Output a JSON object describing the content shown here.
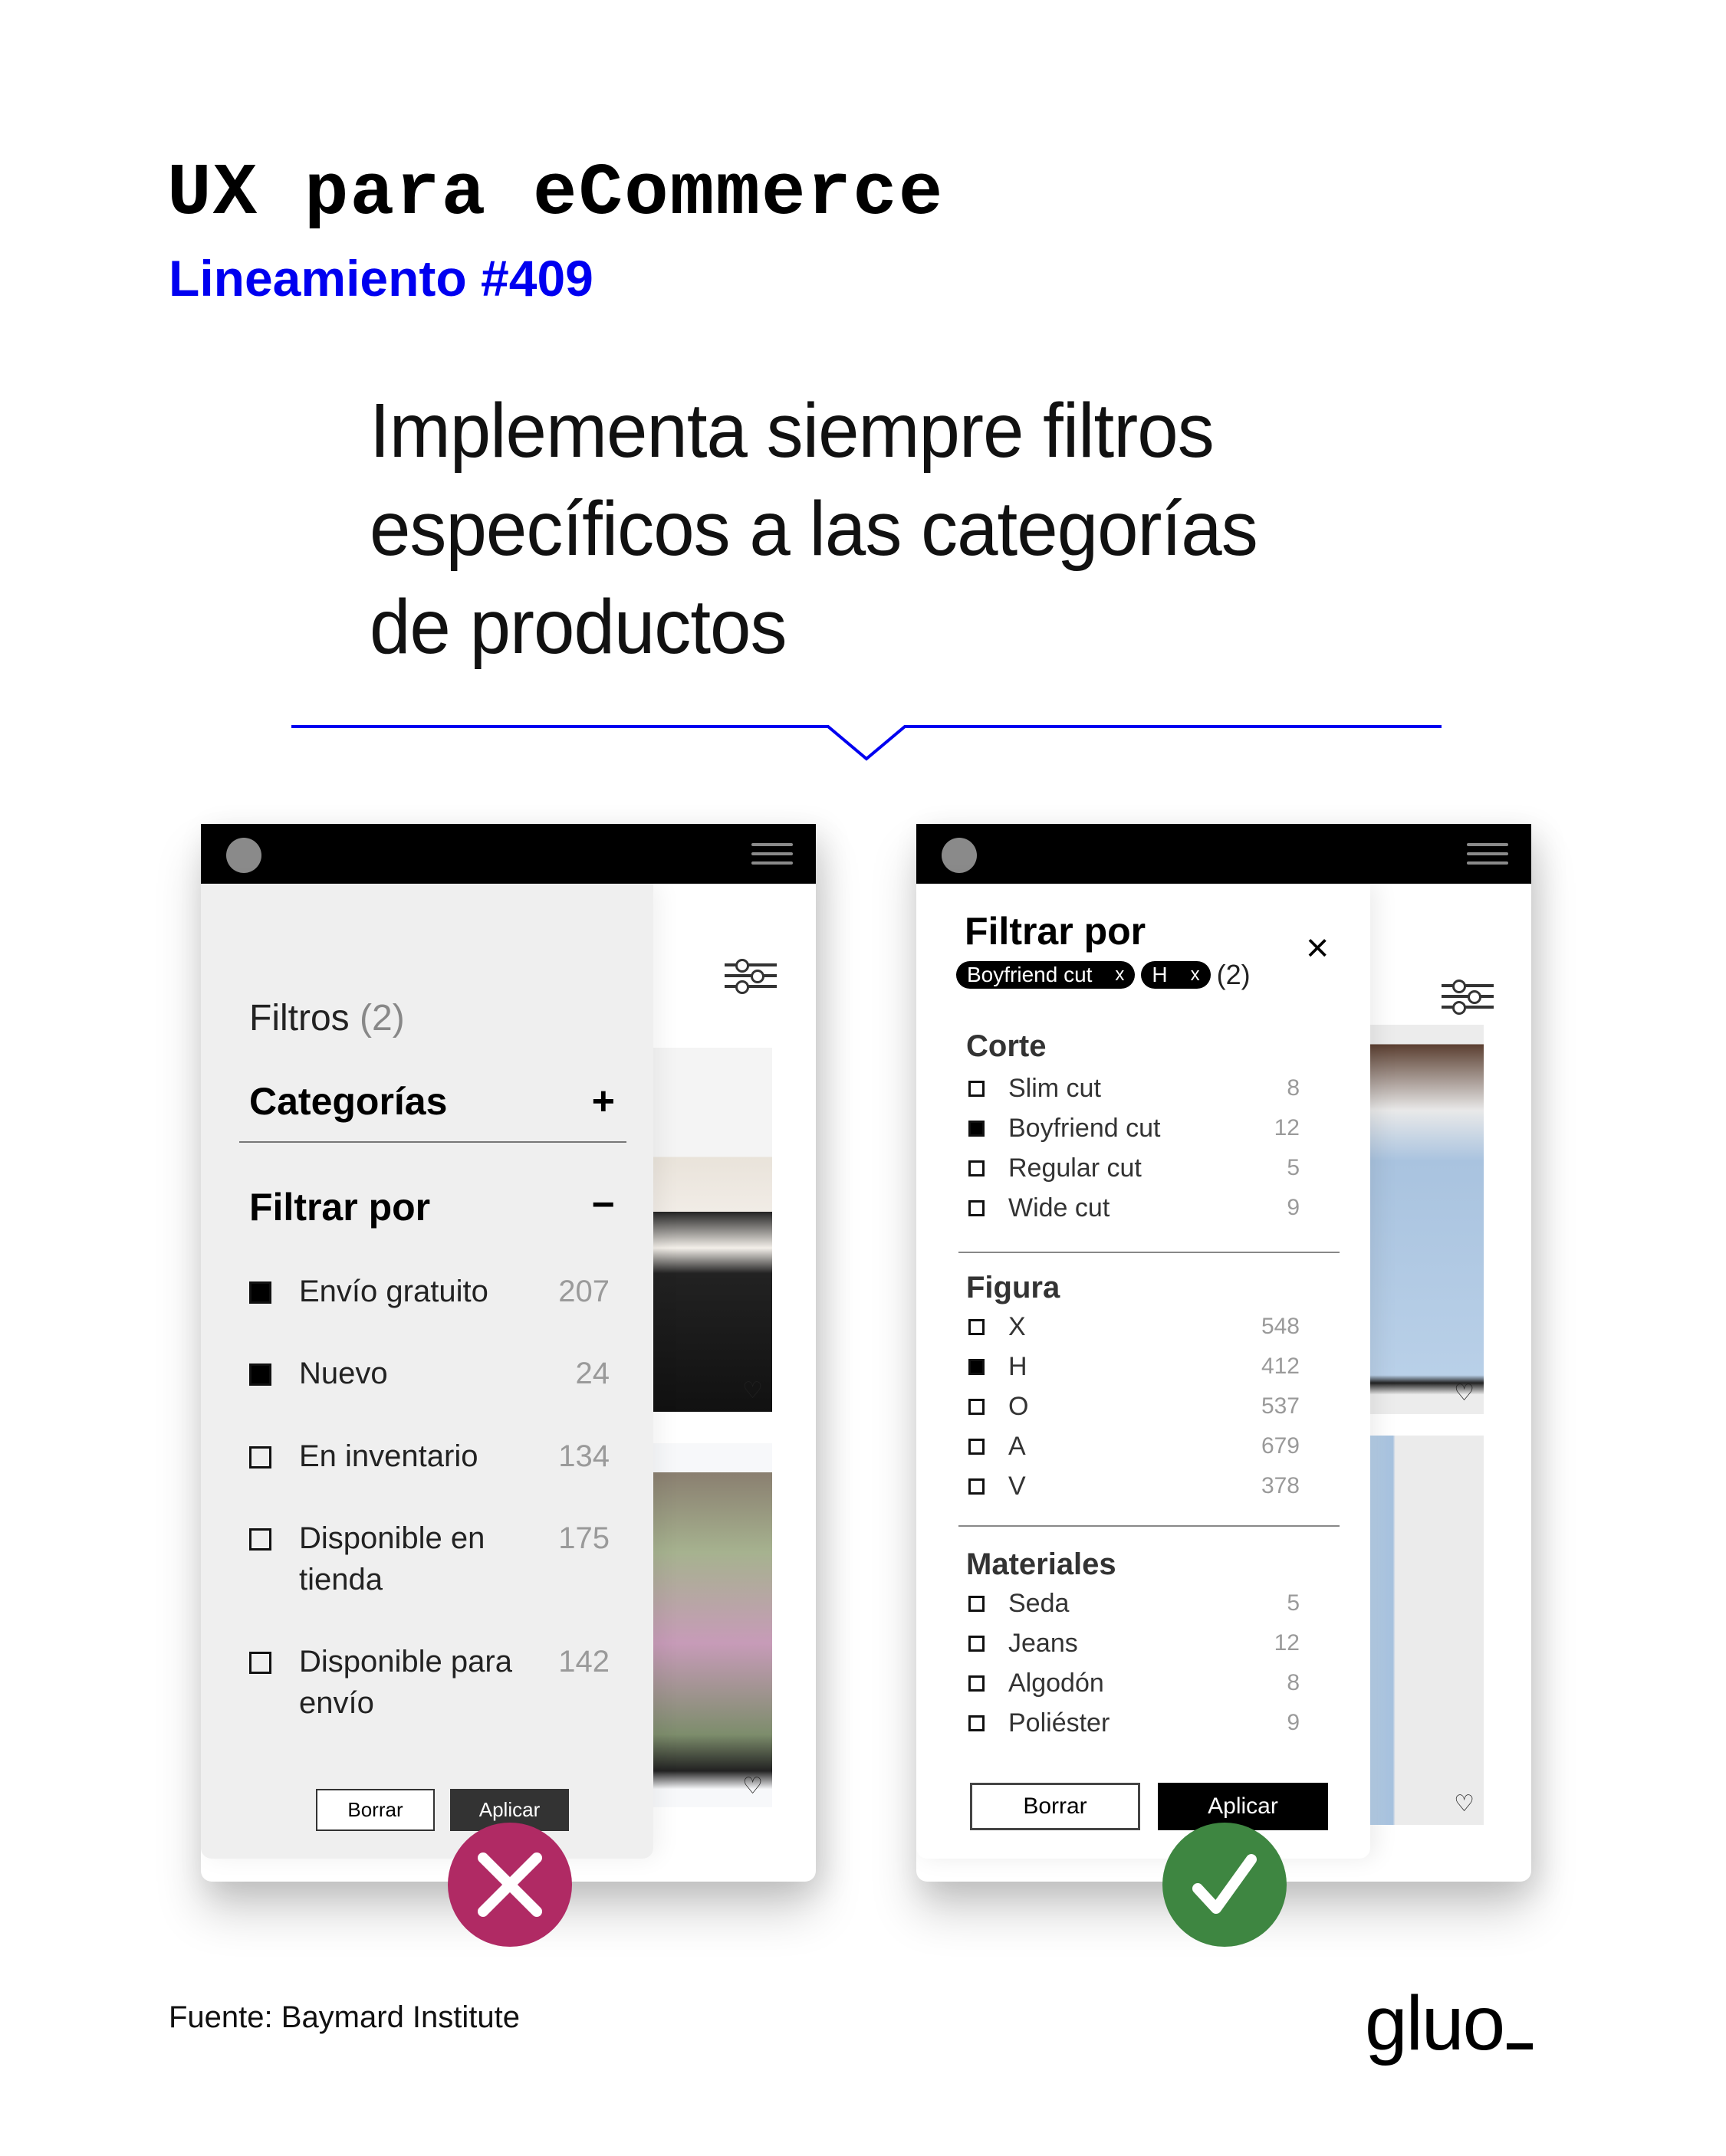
{
  "header": {
    "title": "UX para eCommerce",
    "subtitle": "Lineamiento #409",
    "headline_lines": [
      "Implementa siempre filtros",
      "específicos a las categorías",
      "de productos"
    ]
  },
  "colors": {
    "accent_blue": "#0000f0",
    "bad_badge": "#b02a64",
    "good_badge": "#3e8641",
    "drawer_gray": "#efefef"
  },
  "bad_example": {
    "verdict_icon": "x-mark-icon",
    "drawer": {
      "title": "Filtros",
      "count": "(2)",
      "sections": [
        {
          "label": "Categorías",
          "toggle": "+"
        },
        {
          "label": "Filtrar por",
          "toggle": "−"
        }
      ],
      "items": [
        {
          "label": "Envío gratuito",
          "count": "207",
          "checked": true
        },
        {
          "label": "Nuevo",
          "count": "24",
          "checked": true
        },
        {
          "label": "En inventario",
          "count": "134",
          "checked": false
        },
        {
          "label": "Disponible en tienda",
          "count": "175",
          "checked": false
        },
        {
          "label": "Disponible para envío",
          "count": "142",
          "checked": false
        }
      ],
      "clear_label": "Borrar",
      "apply_label": "Aplicar"
    }
  },
  "good_example": {
    "verdict_icon": "check-mark-icon",
    "drawer": {
      "title": "Filtrar por",
      "close_icon": "×",
      "chips": [
        {
          "label": "Boyfriend cut",
          "remove": "x"
        },
        {
          "label": "H",
          "remove": "x"
        }
      ],
      "chips_count": "(2)",
      "groups": [
        {
          "title": "Corte",
          "items": [
            {
              "label": "Slim cut",
              "count": "8",
              "checked": false
            },
            {
              "label": "Boyfriend cut",
              "count": "12",
              "checked": true
            },
            {
              "label": "Regular cut",
              "count": "5",
              "checked": false
            },
            {
              "label": "Wide cut",
              "count": "9",
              "checked": false
            }
          ]
        },
        {
          "title": "Figura",
          "items": [
            {
              "label": "X",
              "count": "548",
              "checked": false
            },
            {
              "label": "H",
              "count": "412",
              "checked": true
            },
            {
              "label": "O",
              "count": "537",
              "checked": false
            },
            {
              "label": "A",
              "count": "679",
              "checked": false
            },
            {
              "label": "V",
              "count": "378",
              "checked": false
            }
          ]
        },
        {
          "title": "Materiales",
          "items": [
            {
              "label": "Seda",
              "count": "5",
              "checked": false
            },
            {
              "label": "Jeans",
              "count": "12",
              "checked": false
            },
            {
              "label": "Algodón",
              "count": "8",
              "checked": false
            },
            {
              "label": "Poliéster",
              "count": "9",
              "checked": false
            }
          ]
        }
      ],
      "clear_label": "Borrar",
      "apply_label": "Aplicar"
    }
  },
  "footer": {
    "source": "Fuente: Baymard Institute",
    "logo": "gluo"
  }
}
